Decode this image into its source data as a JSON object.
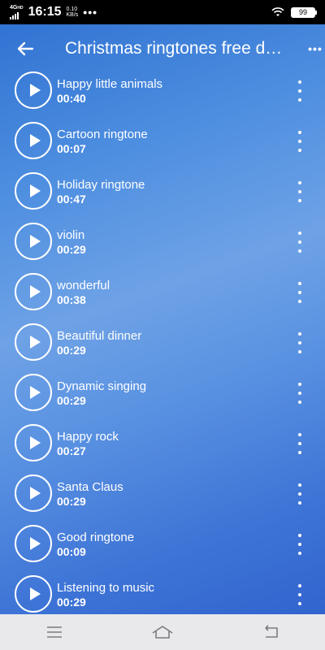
{
  "status_bar": {
    "network": "4G",
    "network_sup": "HD",
    "time": "16:15",
    "speed_value": "0.10",
    "speed_unit": "KB/s",
    "overflow": "•••",
    "battery": "99"
  },
  "header": {
    "title": "Christmas ringtones free d…",
    "overflow": "•••"
  },
  "ringtones": [
    {
      "name": "Happy little animals",
      "duration": "00:40"
    },
    {
      "name": "Cartoon ringtone",
      "duration": "00:07"
    },
    {
      "name": "Holiday ringtone",
      "duration": "00:47"
    },
    {
      "name": "violin",
      "duration": "00:29"
    },
    {
      "name": "wonderful",
      "duration": "00:38"
    },
    {
      "name": "Beautiful dinner",
      "duration": "00:29"
    },
    {
      "name": "Dynamic singing",
      "duration": "00:29"
    },
    {
      "name": "Happy rock",
      "duration": "00:27"
    },
    {
      "name": "Santa Claus",
      "duration": "00:29"
    },
    {
      "name": "Good ringtone",
      "duration": "00:09"
    },
    {
      "name": "Listening to music",
      "duration": "00:29"
    }
  ],
  "navbar": {
    "icons": [
      "menu-icon",
      "home-icon",
      "back-icon"
    ]
  }
}
